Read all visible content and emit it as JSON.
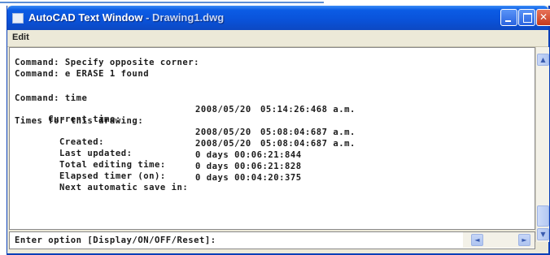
{
  "window": {
    "title": "AutoCAD Text Window",
    "title_file": "- Drawing1.dwg",
    "controls": {
      "minimize": "minimize",
      "maximize": "maximize",
      "close": "✕"
    }
  },
  "menu": {
    "edit": "Edit"
  },
  "history": [
    {
      "text": "Command: Specify opposite corner:"
    },
    {
      "text": "Command: e ERASE 1 found"
    },
    {
      "text": ""
    },
    {
      "text": "Command: time"
    },
    {
      "text": "Current time:",
      "date": "2008/05/20",
      "time": "05:14:26:468 a.m."
    },
    {
      "text": "Times for this drawing:"
    },
    {
      "text": "  Created:",
      "date": "2008/05/20",
      "time": "05:08:04:687 a.m."
    },
    {
      "text": "  Last updated:",
      "date": "2008/05/20",
      "time": "05:08:04:687 a.m."
    },
    {
      "text": "  Total editing time:",
      "date": "0 days 00:06:21:844"
    },
    {
      "text": "  Elapsed timer (on):",
      "date": "0 days 00:06:21:828"
    },
    {
      "text": "  Next automatic save in:",
      "date": "0 days 00:04:20:375"
    }
  ],
  "command_prompt": "Enter option [Display/ON/OFF/Reset]:",
  "icons": {
    "app": "autocad-icon",
    "scroll_up": "▲",
    "scroll_down": "▼",
    "scroll_left": "◄",
    "scroll_right": "►"
  },
  "colors": {
    "titlebar": "#0a52d9",
    "window_face": "#ece9d8",
    "close_button": "#c4391c"
  }
}
